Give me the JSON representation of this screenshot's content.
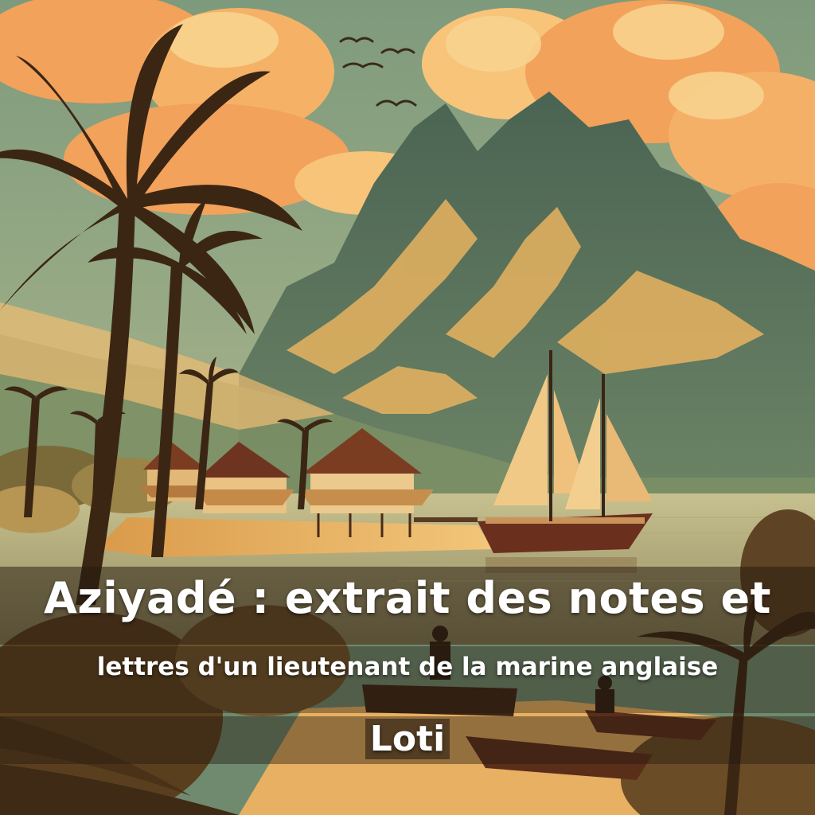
{
  "cover": {
    "title": "Aziyadé : extrait des notes et",
    "subtitle": "lettres d'un lieutenant de la marine anglaise",
    "author": "Loti"
  },
  "palette": {
    "sky": "#7f9a7f",
    "cloud": "#f4a35a",
    "cloud_light": "#f8cf86",
    "mountain": "#4f6a58",
    "mountain_light": "#e9b763",
    "sea": "#c9b77e",
    "sand": "#e8b462",
    "palm_dark": "#3b2614",
    "ship_hull": "#6b2f1d",
    "sail": "#f1c987"
  }
}
